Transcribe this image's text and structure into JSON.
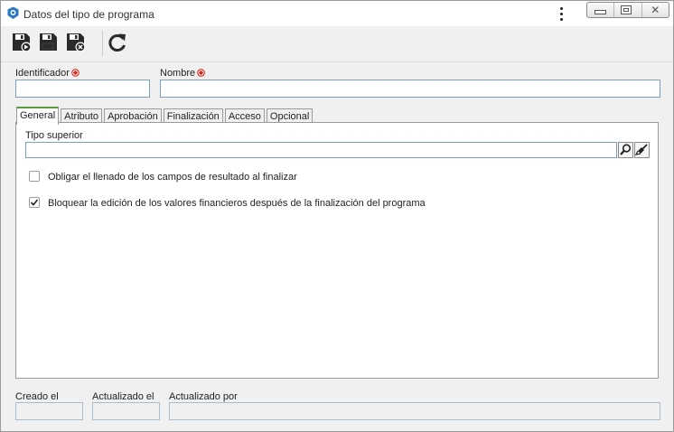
{
  "window": {
    "title": "Datos del tipo de programa"
  },
  "toolbar": {
    "buttons": [
      {
        "icon": "save-and-new-icon"
      },
      {
        "icon": "save-icon"
      },
      {
        "icon": "save-and-close-icon"
      },
      {
        "icon": "refresh-icon"
      }
    ]
  },
  "form": {
    "identificador": {
      "label": "Identificador",
      "value": ""
    },
    "nombre": {
      "label": "Nombre",
      "value": ""
    }
  },
  "tabs": [
    "General",
    "Atributo",
    "Aprobación",
    "Finalización",
    "Acceso",
    "Opcional"
  ],
  "active_tab": "General",
  "general": {
    "tipo_superior": {
      "label": "Tipo superior",
      "value": ""
    },
    "checkboxes": [
      {
        "label": "Obligar el llenado de los campos de resultado al finalizar",
        "checked": false
      },
      {
        "label": "Bloquear la edición de los valores financieros después de la finalización del programa",
        "checked": true
      }
    ]
  },
  "footer": {
    "creado_el": {
      "label": "Creado el",
      "value": ""
    },
    "actualizado_el": {
      "label": "Actualizado el",
      "value": ""
    },
    "actualizado_por": {
      "label": "Actualizado por",
      "value": ""
    }
  },
  "colors": {
    "tab_accent": "#5b9a3c",
    "required_marker": "#d9261c",
    "field_border": "#7a9ebf"
  }
}
